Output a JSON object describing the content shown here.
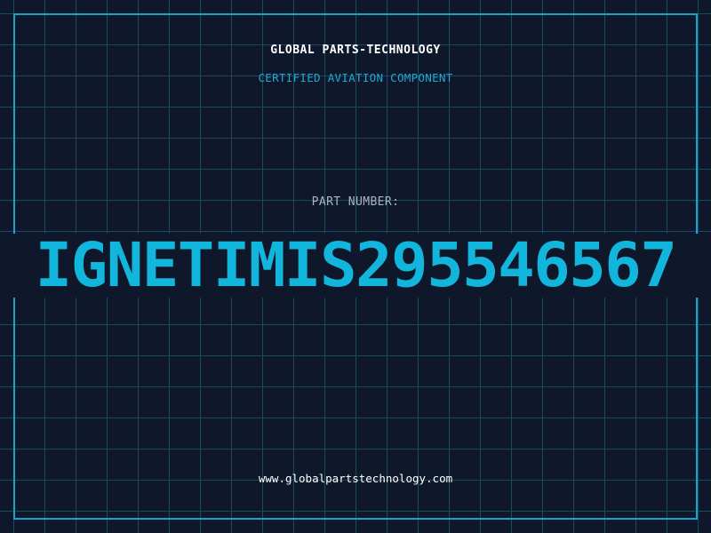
{
  "header": {
    "company": "GLOBAL PARTS-TECHNOLOGY",
    "subtitle": "CERTIFIED AVIATION COMPONENT"
  },
  "part": {
    "label": "PART NUMBER:",
    "number": "IGNETIMIS295546567"
  },
  "footer": {
    "website": "www.globalpartstechnology.com"
  },
  "colors": {
    "background": "#0f172a",
    "grid": "#1a4a62",
    "frame": "#17a5cf",
    "accent": "#12b6dd",
    "subtitle": "#1eaad8",
    "label": "#aab4c2",
    "text": "#ffffff"
  }
}
